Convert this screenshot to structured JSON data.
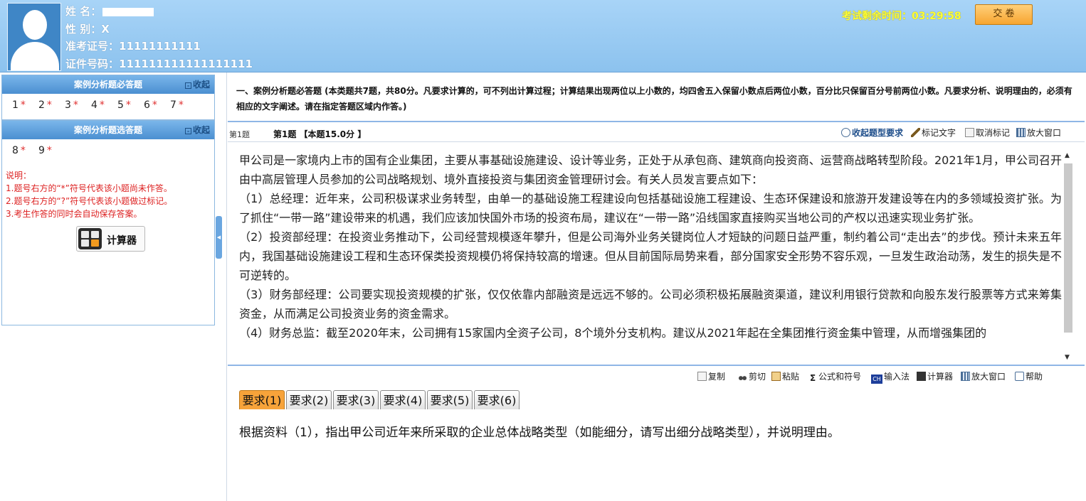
{
  "candidate": {
    "name_label": "姓  名：",
    "gender_label": "性  别：",
    "gender_value": "X",
    "ticket_label": "准考证号：",
    "ticket_value": "11111111111",
    "id_label": "证件号码：",
    "id_value": "111111111111111111"
  },
  "header": {
    "timer_label": "考试剩余时间：",
    "timer_value": "03:29:58",
    "submit_label": "交 卷"
  },
  "sidebar": {
    "required_title": "案例分析题必答题",
    "collapse_label": "收起",
    "required_items": [
      "1",
      "2",
      "3",
      "4",
      "5",
      "6",
      "7"
    ],
    "optional_title": "案例分析题选答题",
    "optional_items": [
      "8",
      "9"
    ],
    "star": "*",
    "notes": [
      "说明：",
      "1.题号右方的“*”符号代表该小题尚未作答。",
      "2.题号右方的“?”符号代表该小题做过标记。",
      "3.考生作答的同时会自动保存答案。"
    ],
    "calculator_label": "计算器"
  },
  "section": {
    "instructions": "一、案例分析题必答题 (本类题共7题，共80分。凡要求计算的，可不列出计算过程；计算结果出现两位以上小数的，均四舍五入保留小数点后两位小数，百分比只保留百分号前两位小数。凡要求分析、说明理由的，必须有相应的文字阐述。请在指定答题区域内作答。)"
  },
  "question_bar": {
    "number": "第1题",
    "title": "第1题 【本题15.0分 】",
    "hide_req": "收起题型要求",
    "mark_text": "标记文字",
    "unmark": "取消标记",
    "enlarge": "放大窗口"
  },
  "material": {
    "paragraphs": [
      "甲公司是一家境内上市的国有企业集团，主要从事基础设施建设、设计等业务，正处于从承包商、建筑商向投资商、运营商战略转型阶段。2021年1月，甲公司召开由中高层管理人员参加的公司战略规划、境外直接投资与集团资金管理研讨会。有关人员发言要点如下：",
      "（1）总经理：近年来，公司积极谋求业务转型，由单一的基础设施工程建设向包括基础设施工程建设、生态环保建设和旅游开发建设等在内的多领域投资扩张。为了抓住“一带一路”建设带来的机遇，我们应该加快国外市场的投资布局，建议在“一带一路”沿线国家直接购买当地公司的产权以迅速实现业务扩张。",
      "（2）投资部经理：在投资业务推动下，公司经营规模逐年攀升，但是公司海外业务关键岗位人才短缺的问题日益严重，制约着公司“走出去”的步伐。预计未来五年内，我国基础设施建设工程和生态环保类投资规模仍将保持较高的增速。但从目前国际局势来看，部分国家安全形势不容乐观，一旦发生政治动荡，发生的损失是不可逆转的。",
      "（3）财务部经理：公司要实现投资规模的扩张，仅仅依靠内部融资是远远不够的。公司必须积极拓展融资渠道，建议利用银行贷款和向股东发行股票等方式来筹集资金，从而满足公司投资业务的资金需求。",
      "（4）财务总监：截至2020年末，公司拥有15家国内全资子公司，8个境外分支机构。建议从2021年起在全集团推行资金集中管理，从而增强集团的"
    ]
  },
  "editor": {
    "copy": "复制",
    "cut": "剪切",
    "paste": "粘贴",
    "formula": "公式和符号",
    "ch": "CH",
    "ime": "输入法",
    "calculator": "计算器",
    "enlarge": "放大窗口",
    "help": "帮助"
  },
  "tabs": [
    "要求(1)",
    "要求(2)",
    "要求(3)",
    "要求(4)",
    "要求(5)",
    "要求(6)"
  ],
  "question_text": "根据资料（1），指出甲公司近年来所采取的企业总体战略类型（如能细分，请写出细分战略类型），并说明理由。",
  "colors": {
    "header_bg": "#8cc2ee",
    "timer": "#ffff33",
    "accent_tab": "#f7a33a",
    "notes_red": "#dd2222"
  }
}
